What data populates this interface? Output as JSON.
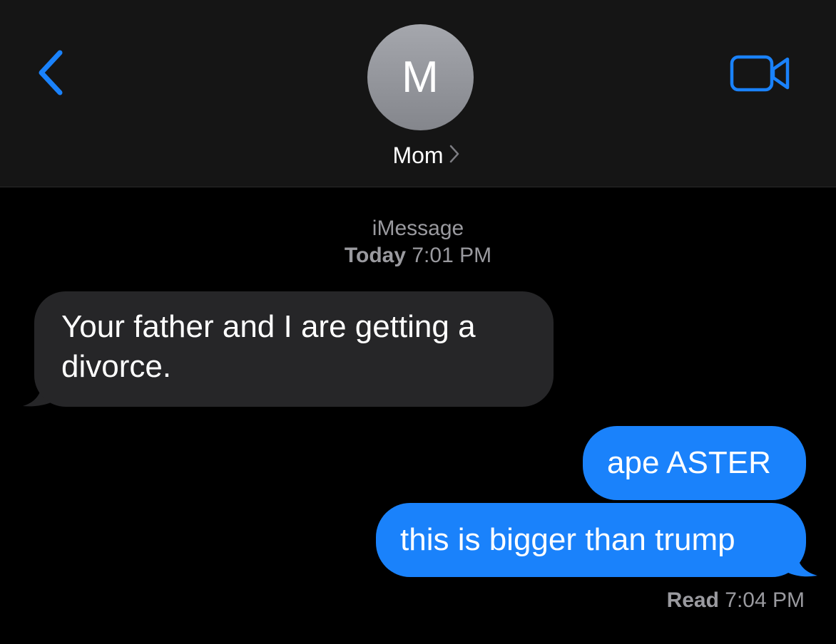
{
  "header": {
    "avatar_initial": "M",
    "contact_name": "Mom",
    "back_icon": "chevron-left-icon",
    "video_icon": "video-camera-icon",
    "accent_color": "#1a82fb"
  },
  "conversation": {
    "service": "iMessage",
    "timestamp_day": "Today",
    "timestamp_time": "7:01 PM",
    "messages": [
      {
        "direction": "incoming",
        "text": "Your father and I are getting a divorce."
      },
      {
        "direction": "outgoing",
        "text": "ape ASTER"
      },
      {
        "direction": "outgoing",
        "text": "this is bigger than trump"
      }
    ],
    "receipt_status": "Read",
    "receipt_time": "7:04 PM"
  },
  "colors": {
    "header_bg": "#151515",
    "background": "#000000",
    "incoming_bubble": "#262628",
    "outgoing_bubble": "#1a82fb",
    "secondary_text": "#9a9a9f"
  }
}
